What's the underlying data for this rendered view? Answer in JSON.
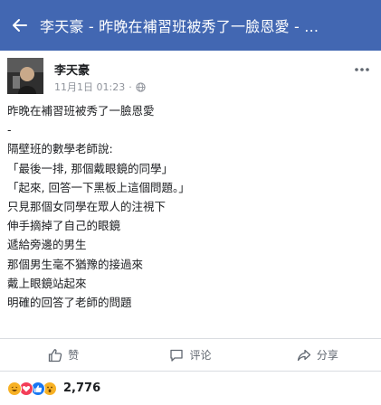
{
  "header": {
    "title": "李天豪 - 昨晚在補習班被秀了一臉恩愛 - ..."
  },
  "post": {
    "author": "李天豪",
    "timestamp": "11月1日 01:23",
    "privacy_icon": "globe-icon",
    "lines": [
      "昨晚在補習班被秀了一臉恩愛",
      "-",
      "隔壁班的數學老師說:",
      "「最後一排, 那個戴眼鏡的同學」",
      "「起來, 回答一下黑板上這個問題。」",
      "只見那個女同學在眾人的注視下",
      "伸手摘掉了自己的眼鏡",
      "遞給旁邊的男生",
      "那個男生毫不猶豫的接過來",
      "戴上眼鏡站起來",
      "明確的回答了老師的問題"
    ]
  },
  "actions": {
    "like": "赞",
    "comment": "评论",
    "share": "分享"
  },
  "reactions": {
    "types": [
      "haha",
      "love",
      "like",
      "wow"
    ],
    "colors": {
      "haha": "#f7b125",
      "love": "#f33e58",
      "like": "#1877f2",
      "wow": "#f7b125"
    },
    "count": "2,776"
  },
  "colors": {
    "header_bg": "#4267b2"
  }
}
